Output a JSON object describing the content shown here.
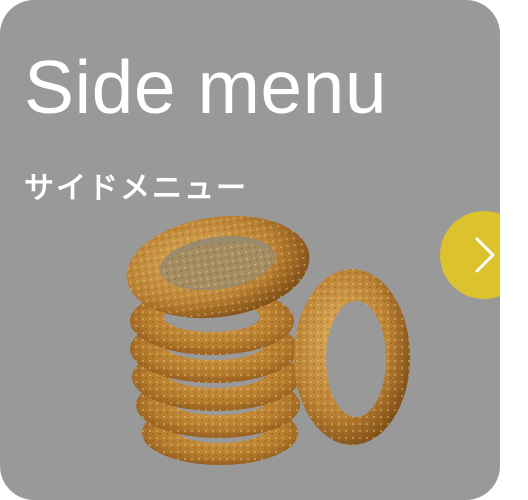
{
  "card": {
    "title": "Side menu",
    "subtitle": "サイドメニュー",
    "image_subject": "onion-rings-photo",
    "background_color": "#999999"
  },
  "next_button": {
    "icon": "chevron-right-icon",
    "color": "#dcc22c"
  }
}
